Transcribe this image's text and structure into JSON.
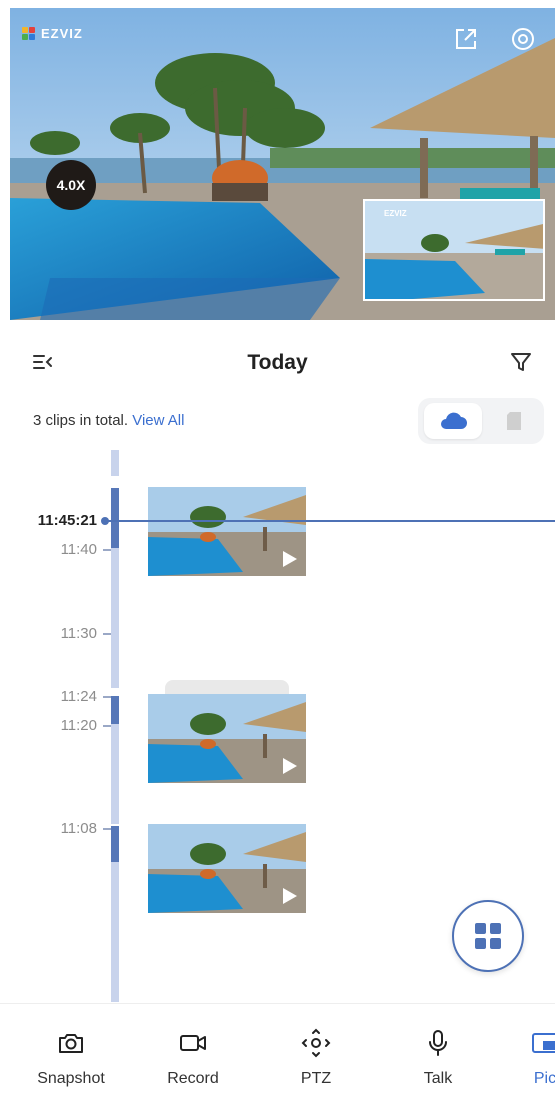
{
  "camera": {
    "brand": "EZVIZ",
    "zoom_level": "4.0X",
    "pip_brand": "EZVIZ"
  },
  "header": {
    "title": "Today"
  },
  "summary": {
    "text": "3 clips in total.",
    "view_all": "View All"
  },
  "storage": {
    "options": [
      "cloud",
      "sd-card"
    ],
    "selected": "cloud"
  },
  "timeline": {
    "current_time": "11:45:21",
    "labels": [
      "11:40",
      "11:30",
      "11:24",
      "11:20",
      "11:08"
    ],
    "clip_count": 3
  },
  "toolbar": {
    "items": [
      {
        "label": "Snapshot",
        "icon": "camera-icon"
      },
      {
        "label": "Record",
        "icon": "video-icon"
      },
      {
        "label": "PTZ",
        "icon": "ptz-icon"
      },
      {
        "label": "Talk",
        "icon": "microphone-icon"
      },
      {
        "label": "Pic",
        "icon": "picture-in-picture-icon"
      }
    ]
  },
  "colors": {
    "accent": "#3b6fcf",
    "timeline_dark": "#5677b8",
    "timeline_light": "#c8d3ec"
  }
}
